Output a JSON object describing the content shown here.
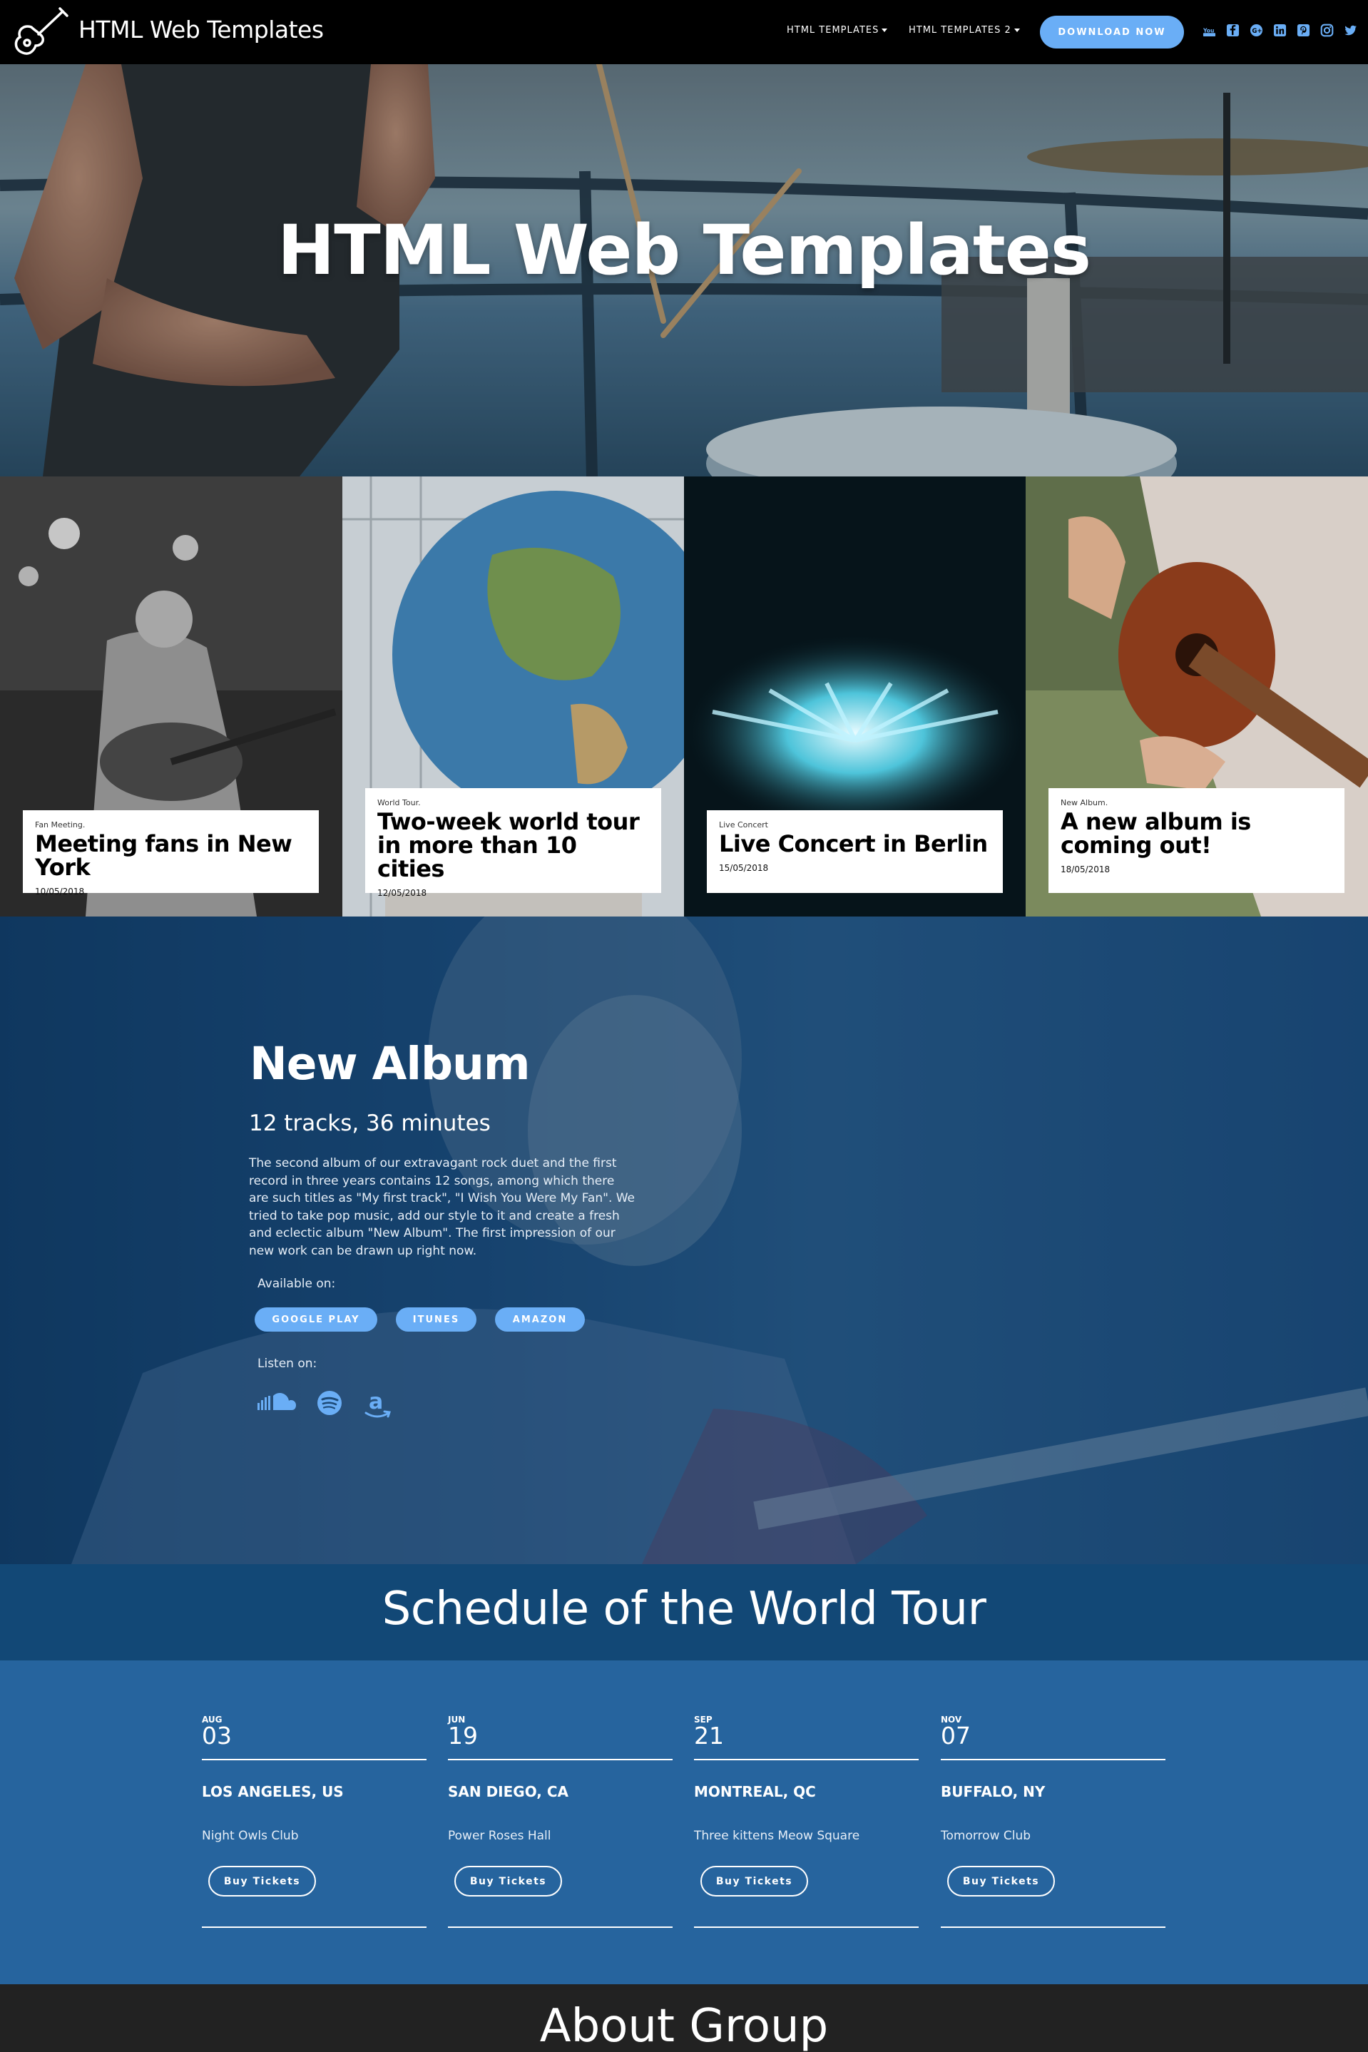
{
  "nav": {
    "brand": "HTML Web Templates",
    "menu": [
      {
        "label": "HTML TEMPLATES"
      },
      {
        "label": "HTML TEMPLATES 2"
      }
    ],
    "download_label": "DOWNLOAD NOW",
    "social_icons": [
      "youtube-icon",
      "facebook-icon",
      "google-plus-icon",
      "linkedin-icon",
      "pinterest-icon",
      "instagram-icon",
      "twitter-icon"
    ],
    "accent": "#6aaef6"
  },
  "hero": {
    "title": "HTML Web Templates"
  },
  "cards": [
    {
      "category": "Fan Meeting.",
      "title": "Meeting fans in New York",
      "date": "10/05/2018"
    },
    {
      "category": "World Tour.",
      "title": "Two-week world tour in more than 10 cities",
      "date": "12/05/2018"
    },
    {
      "category": "Live Concert",
      "title": "Live Concert in Berlin",
      "date": "15/05/2018"
    },
    {
      "category": "New Album.",
      "title": "A new album is coming out!",
      "date": "18/05/2018"
    }
  ],
  "album": {
    "title": "New Album",
    "subtitle": "12 tracks, 36 minutes",
    "description": "The second album of our extravagant rock duet and the first record in three years contains 12 songs, among which there are such titles as \"My first track\", \"I Wish You Were My Fan\". We tried to take pop music, add our style to it and create a fresh and eclectic album \"New Album\". The first impression of our new work can be drawn up right now.",
    "available_label": "Available on:",
    "stores": [
      "GOOGLE PLAY",
      "ITUNES",
      "AMAZON"
    ],
    "listen_label": "Listen on:",
    "listen_icons": [
      "soundcloud-icon",
      "spotify-icon",
      "amazon-icon"
    ]
  },
  "schedule": {
    "title": "Schedule of the World Tour",
    "buy_label": "Buy Tickets",
    "events": [
      {
        "month": "AUG",
        "day": "03",
        "city": "LOS ANGELES, US",
        "venue": "Night Owls Club"
      },
      {
        "month": "JUN",
        "day": "19",
        "city": "SAN DIEGO, CA",
        "venue": "Power Roses Hall"
      },
      {
        "month": "SEP",
        "day": "21",
        "city": "MONTREAL, QC",
        "venue": "Three kittens Meow Square"
      },
      {
        "month": "NOV",
        "day": "07",
        "city": "BUFFALO, NY",
        "venue": "Tomorrow Club"
      }
    ]
  },
  "about": {
    "title": "About Group"
  }
}
